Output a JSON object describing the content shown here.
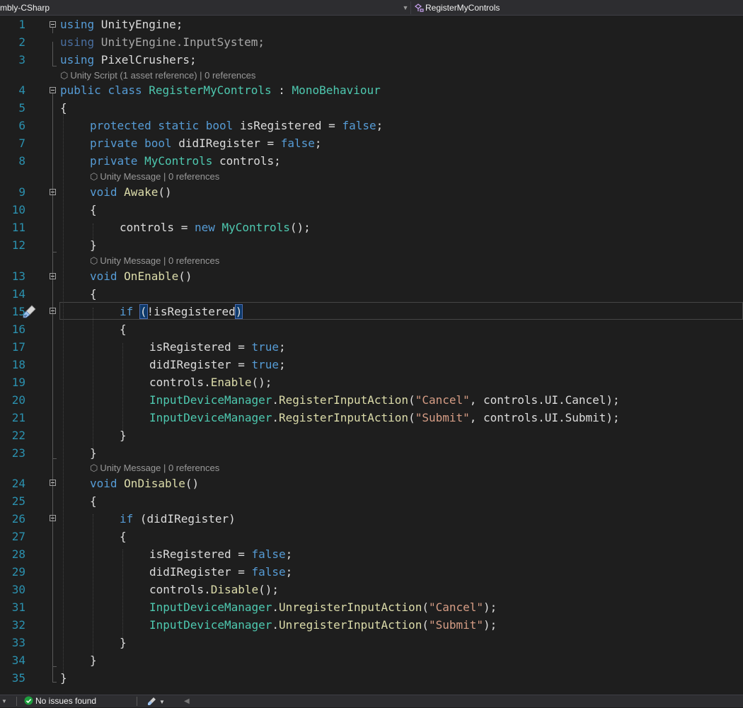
{
  "navbar": {
    "project_dropdown": "mbly-CSharp",
    "member_dropdown": "RegisterMyControls"
  },
  "codelens": {
    "class": "Unity Script (1 asset reference) | 0 references",
    "awake": "Unity Message | 0 references",
    "onenable": "Unity Message | 0 references",
    "ondisable": "Unity Message | 0 references"
  },
  "line_numbers": [
    "1",
    "2",
    "3",
    "4",
    "5",
    "6",
    "7",
    "8",
    "9",
    "10",
    "11",
    "12",
    "13",
    "14",
    "15",
    "16",
    "17",
    "18",
    "19",
    "20",
    "21",
    "22",
    "23",
    "24",
    "25",
    "26",
    "27",
    "28",
    "29",
    "30",
    "31",
    "32",
    "33",
    "34",
    "35"
  ],
  "code": {
    "l1": [
      "using",
      " UnityEngine;"
    ],
    "l2": [
      "using",
      " UnityEngine.InputSystem;"
    ],
    "l3": [
      "using",
      " PixelCrushers;"
    ],
    "l4": [
      "public",
      " ",
      "class",
      " ",
      "RegisterMyControls",
      " : ",
      "MonoBehaviour"
    ],
    "l5": [
      "{"
    ],
    "l6": [
      "protected",
      " ",
      "static",
      " ",
      "bool",
      " isRegistered = ",
      "false",
      ";"
    ],
    "l7": [
      "private",
      " ",
      "bool",
      " didIRegister = ",
      "false",
      ";"
    ],
    "l8": [
      "private",
      " ",
      "MyControls",
      " controls;"
    ],
    "l9": [
      "void",
      " ",
      "Awake",
      "()"
    ],
    "l10": [
      "{"
    ],
    "l11": [
      "controls = ",
      "new",
      " ",
      "MyControls",
      "();"
    ],
    "l12": [
      "}"
    ],
    "l13": [
      "void",
      " ",
      "OnEnable",
      "()"
    ],
    "l14": [
      "{"
    ],
    "l15": [
      "if",
      " ",
      "(",
      "!isRegistered",
      ")"
    ],
    "l16": [
      "{"
    ],
    "l17": [
      "isRegistered = ",
      "true",
      ";"
    ],
    "l18": [
      "didIRegister = ",
      "true",
      ";"
    ],
    "l19": [
      "controls.",
      "Enable",
      "();"
    ],
    "l20": [
      "InputDeviceManager",
      ".",
      "RegisterInputAction",
      "(",
      "\"Cancel\"",
      ", controls.UI.Cancel);"
    ],
    "l21": [
      "InputDeviceManager",
      ".",
      "RegisterInputAction",
      "(",
      "\"Submit\"",
      ", controls.UI.Submit);"
    ],
    "l22": [
      "}"
    ],
    "l23": [
      "}"
    ],
    "l24": [
      "void",
      " ",
      "OnDisable",
      "()"
    ],
    "l25": [
      "{"
    ],
    "l26": [
      "if",
      " (didIRegister)"
    ],
    "l27": [
      "{"
    ],
    "l28": [
      "isRegistered = ",
      "false",
      ";"
    ],
    "l29": [
      "didIRegister = ",
      "false",
      ";"
    ],
    "l30": [
      "controls.",
      "Disable",
      "();"
    ],
    "l31": [
      "InputDeviceManager",
      ".",
      "UnregisterInputAction",
      "(",
      "\"Cancel\"",
      ");"
    ],
    "l32": [
      "InputDeviceManager",
      ".",
      "UnregisterInputAction",
      "(",
      "\"Submit\"",
      ");"
    ],
    "l33": [
      "}"
    ],
    "l34": [
      "}"
    ],
    "l35": [
      "}"
    ]
  },
  "statusbar": {
    "issues": "No issues found"
  },
  "colors": {
    "keyword": "#569cd6",
    "type": "#4ec9b0",
    "string": "#d69d85",
    "method": "#dcdcaa",
    "line_number": "#2b91af",
    "background": "#1e1e1e"
  }
}
